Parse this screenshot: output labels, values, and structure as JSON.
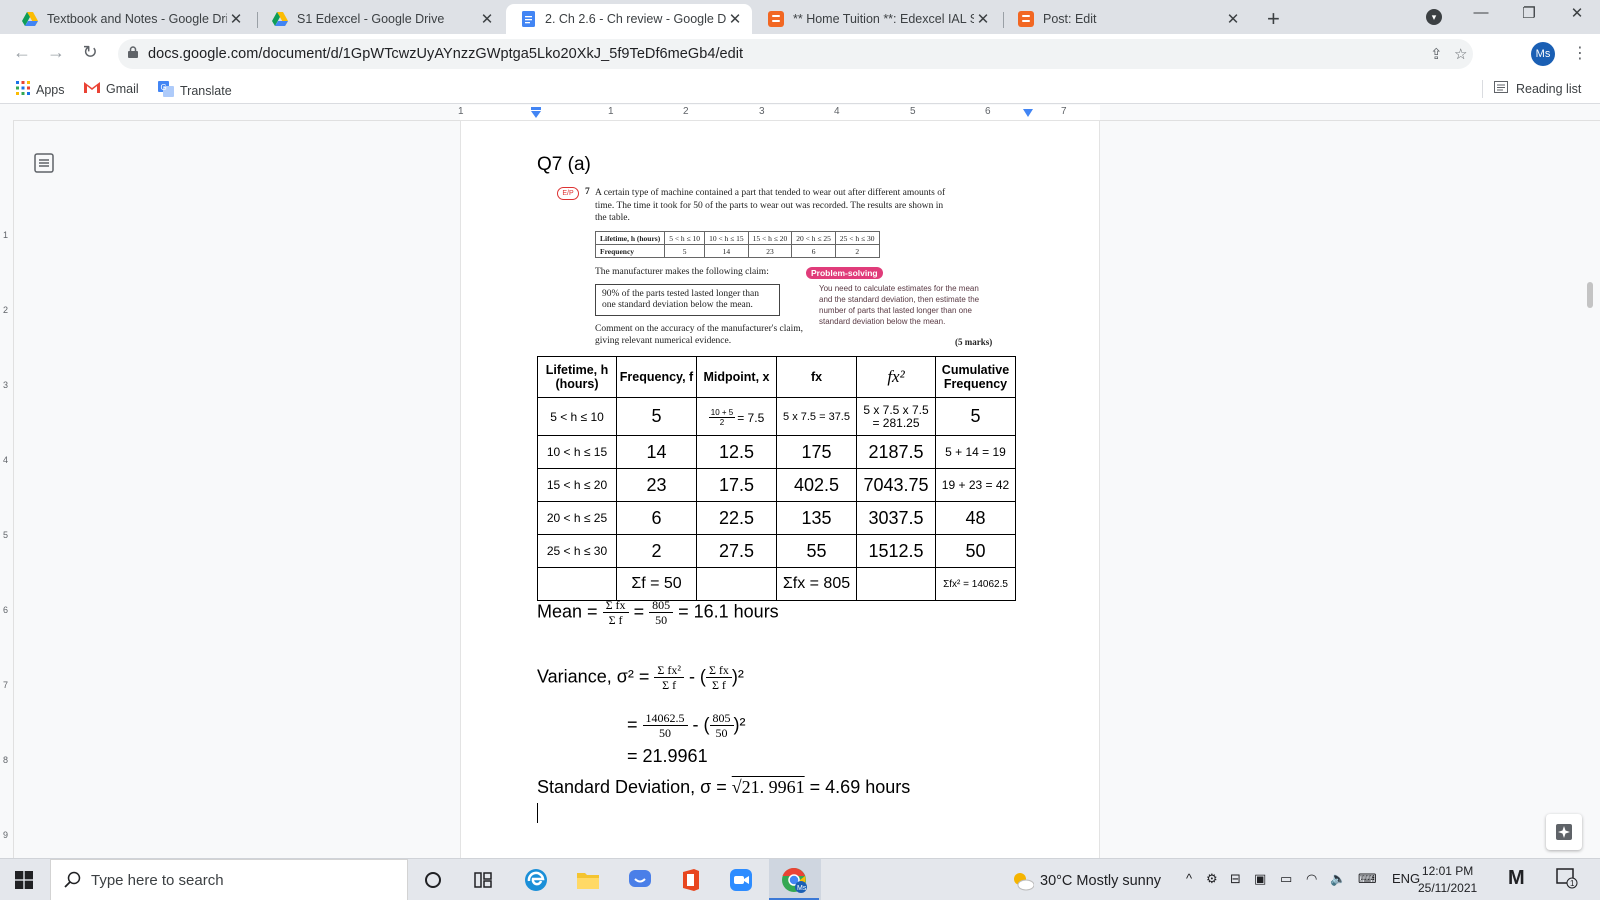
{
  "browser": {
    "tabs": [
      {
        "title": "Textbook and Notes - Google Dri",
        "icon": "google-drive-icon",
        "active": false
      },
      {
        "title": "S1 Edexcel - Google Drive",
        "icon": "google-drive-icon",
        "active": false
      },
      {
        "title": "2. Ch 2.6 - Ch review - Google Do",
        "icon": "google-docs-icon",
        "active": true
      },
      {
        "title": "** Home Tuition **: Edexcel IAL S",
        "icon": "blogger-icon",
        "active": false
      },
      {
        "title": "Post: Edit",
        "icon": "blogger-icon",
        "active": false
      }
    ],
    "url": "docs.google.com/document/d/1GpWTcwzUyAYnzzGWptga5Lko20XkJ_5f9TeDf6meGb4/edit",
    "profile_initials": "Ms",
    "bookmarks": {
      "apps": "Apps",
      "gmail": "Gmail",
      "translate": "Translate",
      "reading_list": "Reading list"
    }
  },
  "ruler": {
    "marks": [
      "1",
      "1",
      "2",
      "3",
      "4",
      "5",
      "6",
      "7"
    ],
    "vmarks": [
      "1",
      "2",
      "3",
      "4",
      "5",
      "6",
      "7",
      "8",
      "9"
    ]
  },
  "doc": {
    "heading": "Q7 (a)",
    "textbook": {
      "badge": "E/P",
      "number": "7",
      "intro": "A certain type of machine contained a part that tended to wear out after different amounts of time. The time it took for 50 of the parts to wear out was recorded. The results are shown in the table.",
      "table_headers": [
        "Lifetime, h (hours)",
        "5 < h ≤ 10",
        "10 < h ≤ 15",
        "15 < h ≤ 20",
        "20 < h ≤ 25",
        "25 < h ≤ 30"
      ],
      "table_row_label": "Frequency",
      "table_values": [
        "5",
        "14",
        "23",
        "6",
        "2"
      ],
      "claim_intro": "The manufacturer makes the following claim:",
      "claim": "90% of the parts tested lasted longer than one standard deviation below the mean.",
      "comment": "Comment on the accuracy of the manufacturer's claim, giving relevant numerical evidence.",
      "ps_label": "Problem-solving",
      "ps_text": "You need to calculate estimates for the mean and the standard deviation, then estimate the number of parts that lasted longer than one standard deviation below the mean.",
      "marks": "(5 marks)"
    },
    "table": {
      "headers": [
        "Lifetime, h (hours)",
        "Frequency, f",
        "Midpoint, x",
        "fx",
        "fx²",
        "Cumulative Frequency"
      ],
      "row1": {
        "lifetime": "5 < h ≤ 10",
        "freq": "5",
        "mid_num": "10 + 5",
        "mid_den": "2",
        "mid_res": "= 7.5",
        "fx": "5 x 7.5 = 37.5",
        "fx2_a": "5 x 7.5 x 7.5",
        "fx2_b": "= 281.25",
        "cum": "5"
      },
      "rows": [
        {
          "lifetime": "10 < h ≤ 15",
          "freq": "14",
          "mid": "12.5",
          "fx": "175",
          "fx2": "2187.5",
          "cum": "5 + 14 = 19"
        },
        {
          "lifetime": "15 < h ≤ 20",
          "freq": "23",
          "mid": "17.5",
          "fx": "402.5",
          "fx2": "7043.75",
          "cum": "19 + 23 = 42"
        },
        {
          "lifetime": "20 < h ≤ 25",
          "freq": "6",
          "mid": "22.5",
          "fx": "135",
          "fx2": "3037.5",
          "cum": "48"
        },
        {
          "lifetime": "25 < h ≤ 30",
          "freq": "2",
          "mid": "27.5",
          "fx": "55",
          "fx2": "1512.5",
          "cum": "50"
        }
      ],
      "totals": {
        "f": "Σf = 50",
        "fx": "Σfx = 805",
        "fx2": "Σfx² = 14062.5"
      }
    },
    "mean": {
      "label": "Mean =",
      "num": "Σ fx",
      "den": "Σ f",
      "eq": "=",
      "num2": "805",
      "den2": "50",
      "result": "= 16.1 hours"
    },
    "variance": {
      "label": "Variance, σ² =",
      "t1_num": "Σ fx²",
      "t1_den": "Σ f",
      "minus": "- (",
      "t2_num": "Σ fx",
      "t2_den": "Σ f",
      "close": ")²",
      "line2_eq": "=",
      "l2_num": "14062.5",
      "l2_den": "50",
      "l2_minus": "- (",
      "l2_num2": "805",
      "l2_den2": "50",
      "l2_close": ")²",
      "result": "= 21.9961"
    },
    "sd": {
      "label": "Standard Deviation, σ  =",
      "root": "√21. 9961",
      "result": "= 4.69 hours"
    }
  },
  "taskbar": {
    "search_placeholder": "Type here to search",
    "weather": "30°C  Mostly sunny",
    "lang": "ENG",
    "time": "12:01 PM",
    "date": "25/11/2021",
    "notif_count": "1"
  }
}
